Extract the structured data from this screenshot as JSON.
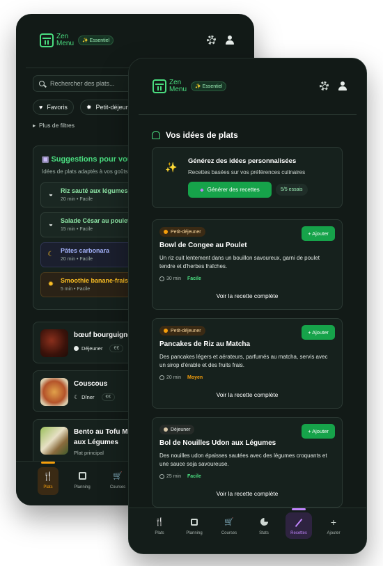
{
  "back": {
    "header": {
      "logo_line1": "Zen",
      "logo_line2": "Menu",
      "plan_badge": "✨ Essentiel"
    },
    "search": {
      "placeholder": "Rechercher des plats..."
    },
    "chips": [
      "Favoris",
      "Petit-déjeuner"
    ],
    "more_filters": "Plus de filtres",
    "suggestions": {
      "title": "Suggestions pour vous",
      "subtitle": "Idées de plats adaptés à vos goûts",
      "items": [
        {
          "name": "Riz sauté aux légumes",
          "meta": "20 min • Facile",
          "color": "#8ee6a6",
          "icon": "bowl-icon"
        },
        {
          "name": "Salade César au poulet",
          "meta": "15 min • Facile",
          "color": "#8ee6a6",
          "icon": "bowl-icon"
        },
        {
          "name": "Pâtes carbonara",
          "meta": "20 min • Facile",
          "color": "#a5b4fc",
          "icon": "moon-icon"
        },
        {
          "name": "Smoothie banane-fraise",
          "meta": "5 min • Facile",
          "color": "#fbbf24",
          "icon": "sun-icon"
        }
      ]
    },
    "recipes": [
      {
        "title": "bœuf bourguignon",
        "meal": "Déjeuner",
        "price": "€€"
      },
      {
        "title": "Couscous",
        "meal": "Dîner",
        "price": "€€"
      },
      {
        "title_line1": "Bento au Tofu Mariné",
        "title_line2": "aux Légumes",
        "category": "Plat principal"
      }
    ],
    "nav": [
      {
        "label": "Plats",
        "icon": "utensils-icon",
        "active": true
      },
      {
        "label": "Planning",
        "icon": "calendar-icon"
      },
      {
        "label": "Courses",
        "icon": "cart-icon"
      }
    ]
  },
  "front": {
    "header": {
      "logo_line1": "Zen",
      "logo_line2": "Menu",
      "plan_badge": "✨ Essentiel"
    },
    "section_title": "Vos idées de plats",
    "generator": {
      "title": "Générez des idées personnalisées",
      "subtitle": "Recettes basées sur vos préférences culinaires",
      "button": "Générer des recettes",
      "quota": "5/5 essais"
    },
    "recipes": [
      {
        "category": "Petit-déjeuner",
        "title": "Bowl de Congee au Poulet",
        "description": "Un riz cuit lentement dans un bouillon savoureux, garni de poulet tendre et d'herbes fraîches.",
        "time": "30 min",
        "difficulty": "Facile",
        "add": "+ Ajouter",
        "link": "Voir la recette complète"
      },
      {
        "category": "Petit-déjeuner",
        "title": "Pancakes de Riz au Matcha",
        "description": "Des pancakes légers et aérateurs, parfumés au matcha, servis avec un sirop d'érable et des fruits frais.",
        "time": "20 min",
        "difficulty": "Moyen",
        "add": "+ Ajouter",
        "link": "Voir la recette complète"
      },
      {
        "category": "Déjeuner",
        "title": "Bol de Nouilles Udon aux Légumes",
        "description": "Des nouilles udon épaisses sautées avec des légumes croquants et une sauce soja savoureuse.",
        "time": "25 min",
        "difficulty": "Facile",
        "add": "+ Ajouter",
        "link": "Voir la recette complète"
      }
    ],
    "nav": [
      {
        "label": "Plats",
        "icon": "utensils-icon"
      },
      {
        "label": "Planning",
        "icon": "calendar-icon"
      },
      {
        "label": "Courses",
        "icon": "cart-icon"
      },
      {
        "label": "Stats",
        "icon": "pie-chart-icon"
      },
      {
        "label": "Recettes",
        "icon": "wand-icon",
        "active": true
      },
      {
        "label": "Ajouter",
        "icon": "plus-icon"
      }
    ]
  },
  "colors": {
    "accent_green": "#4ade80",
    "button_green": "#16a34a",
    "background": "#121a17",
    "easy": "#4ade80",
    "medium": "#f59e0b",
    "breakfast_chip": "#f59e0b",
    "active_plats": "#f59e0b",
    "active_recettes": "#c084fc"
  }
}
